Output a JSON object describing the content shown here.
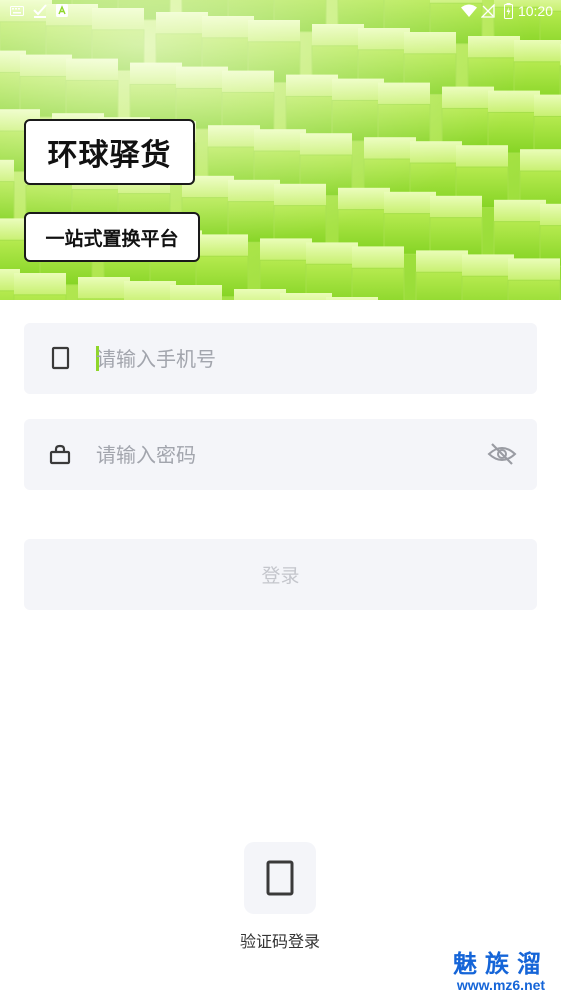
{
  "status_bar": {
    "time": "10:20",
    "left_icons": [
      "keyboard-icon",
      "download-check-icon",
      "a-letter-icon"
    ],
    "right_icons": [
      "wifi-icon",
      "no-signal-icon",
      "battery-icon"
    ]
  },
  "hero": {
    "title": "环球驿货",
    "subtitle": "一站式置换平台",
    "colors": {
      "green_light": "#c6f06a",
      "green_dark": "#7ed321"
    }
  },
  "form": {
    "phone": {
      "icon": "phone-icon",
      "placeholder": "请输入手机号",
      "value": ""
    },
    "password": {
      "icon": "lock-icon",
      "placeholder": "请输入密码",
      "value": "",
      "toggle_icon": "eye-off-icon"
    },
    "login_label": "登录"
  },
  "alt_login": {
    "icon": "phone-icon",
    "label": "验证码登录"
  },
  "watermark": {
    "text": "魅族溜",
    "url": "www.mz6.net"
  },
  "colors": {
    "field_bg": "#f4f5f9",
    "placeholder": "#a2a5ad",
    "cursor": "#8fd62a",
    "watermark": "#1565d8"
  }
}
